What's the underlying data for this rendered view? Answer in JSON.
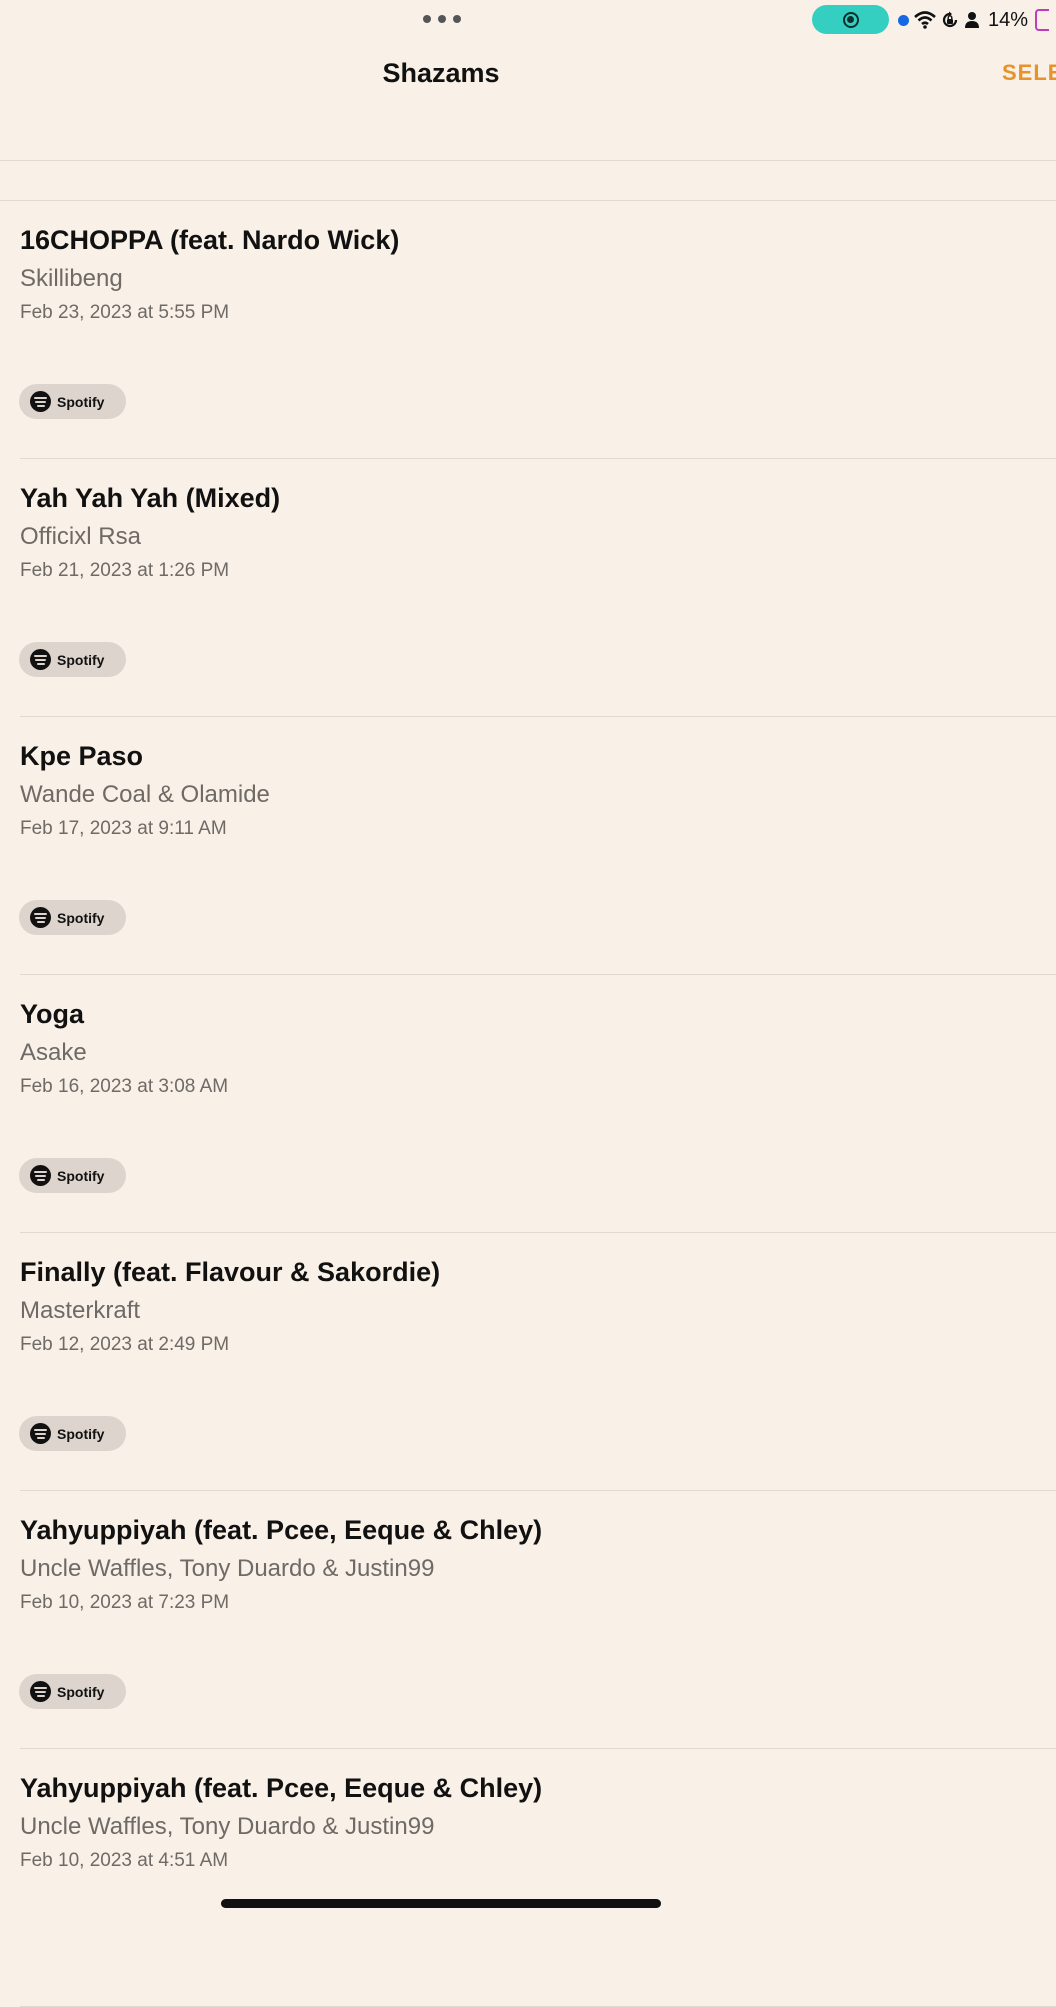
{
  "colors": {
    "background": "#f9f0e7",
    "accent": "#e8922a",
    "record_pill": "#35cfc2",
    "blue_dot": "#1668e3"
  },
  "status_bar": {
    "battery_percent": "14%",
    "icons": [
      "more-dots-icon",
      "screen-record-icon",
      "blue-dot-icon",
      "wifi-icon",
      "orientation-lock-icon",
      "person-icon",
      "battery-icon"
    ]
  },
  "nav": {
    "title": "Shazams",
    "select_label": "SELE"
  },
  "songs": [
    {
      "title": "16CHOPPA (feat. Nardo Wick)",
      "artist": "Skillibeng",
      "date": "Feb 23, 2023 at 5:55 PM",
      "service": "Spotify"
    },
    {
      "title": "Yah Yah Yah (Mixed)",
      "artist": "Officixl Rsa",
      "date": "Feb 21, 2023 at 1:26 PM",
      "service": "Spotify"
    },
    {
      "title": "Kpe Paso",
      "artist": "Wande Coal & Olamide",
      "date": "Feb 17, 2023 at 9:11 AM",
      "service": "Spotify"
    },
    {
      "title": "Yoga",
      "artist": "Asake",
      "date": "Feb 16, 2023 at 3:08 AM",
      "service": "Spotify"
    },
    {
      "title": "Finally (feat. Flavour & Sakordie)",
      "artist": "Masterkraft",
      "date": "Feb 12, 2023 at 2:49 PM",
      "service": "Spotify"
    },
    {
      "title": "Yahyuppiyah (feat. Pcee, Eeque & Chley)",
      "artist": "Uncle Waffles, Tony Duardo & Justin99",
      "date": "Feb 10, 2023 at 7:23 PM",
      "service": "Spotify"
    },
    {
      "title": "Yahyuppiyah (feat. Pcee, Eeque & Chley)",
      "artist": "Uncle Waffles, Tony Duardo & Justin99",
      "date": "Feb 10, 2023 at 4:51 AM"
    }
  ]
}
